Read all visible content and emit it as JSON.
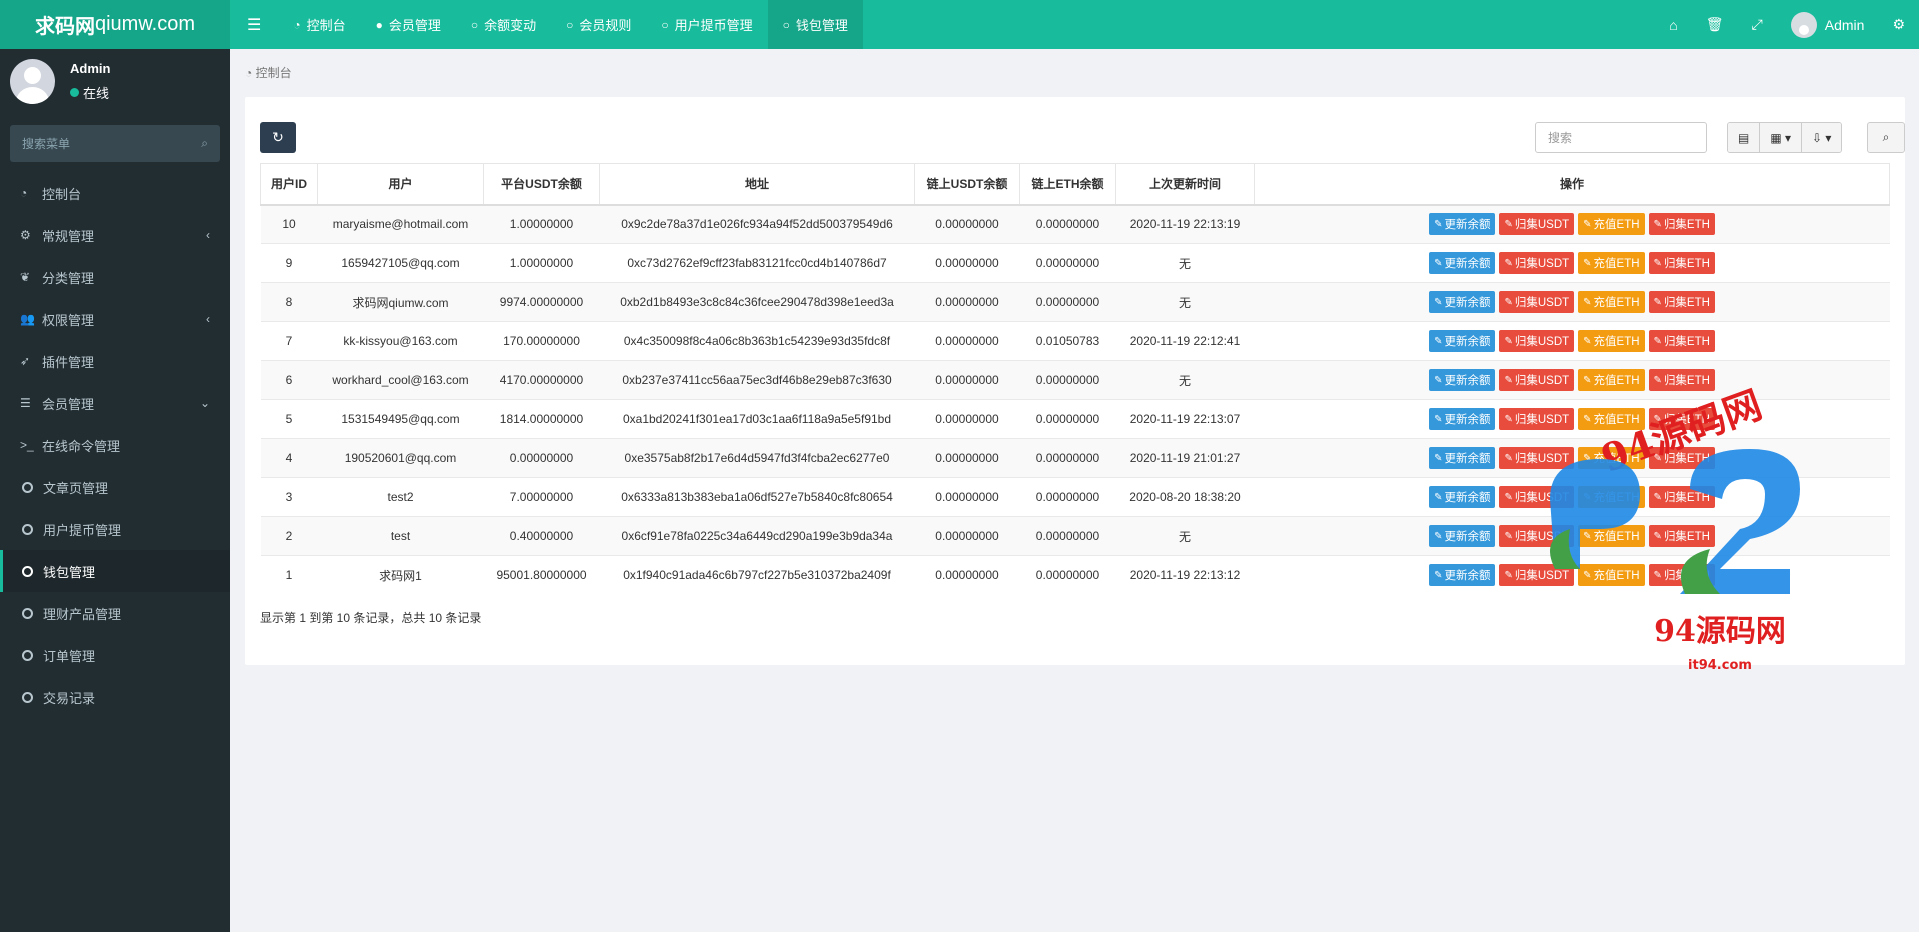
{
  "brand": {
    "title_bold": "求码网",
    "title_rest": "qiumw.com"
  },
  "topnav": {
    "menu_icon": "hamburger-icon",
    "items": [
      {
        "label": "控制台",
        "icon": "dashboard-icon"
      },
      {
        "label": "会员管理",
        "icon": "user-icon"
      },
      {
        "label": "余额变动",
        "icon": "circle-icon"
      },
      {
        "label": "会员规则",
        "icon": "circle-icon"
      },
      {
        "label": "用户提币管理",
        "icon": "circle-icon"
      },
      {
        "label": "钱包管理",
        "icon": "circle-icon",
        "active": true
      }
    ],
    "user_name": "Admin"
  },
  "sidebar": {
    "user_name": "Admin",
    "status": "在线",
    "search_placeholder": "搜索菜单",
    "items": [
      {
        "label": "控制台"
      },
      {
        "label": "常规管理"
      },
      {
        "label": "分类管理"
      },
      {
        "label": "权限管理"
      },
      {
        "label": "插件管理"
      },
      {
        "label": "会员管理"
      },
      {
        "label": "在线命令管理"
      },
      {
        "label": "文章页管理"
      },
      {
        "label": "用户提币管理"
      },
      {
        "label": "钱包管理",
        "active": true
      },
      {
        "label": "理财产品管理"
      },
      {
        "label": "订单管理"
      },
      {
        "label": "交易记录"
      }
    ]
  },
  "breadcrumb": "控制台",
  "toolbar": {
    "search_placeholder": "搜索"
  },
  "table": {
    "headers": [
      "用户ID",
      "用户",
      "平台USDT余额",
      "地址",
      "链上USDT余额",
      "链上ETH余额",
      "上次更新时间",
      "操作"
    ],
    "actions": [
      "更新余额",
      "归集USDT",
      "充值ETH",
      "归集ETH"
    ],
    "rows": [
      [
        "10",
        "maryaisme@hotmail.com",
        "1.00000000",
        "0x9c2de78a37d1e026fc934a94f52dd500379549d6",
        "0.00000000",
        "0.00000000",
        "2020-11-19 22:13:19"
      ],
      [
        "9",
        "1659427105@qq.com",
        "1.00000000",
        "0xc73d2762ef9cff23fab83121fcc0cd4b140786d7",
        "0.00000000",
        "0.00000000",
        "无"
      ],
      [
        "8",
        "求码网qiumw.com",
        "9974.00000000",
        "0xb2d1b8493e3c8c84c36fcee290478d398e1eed3a",
        "0.00000000",
        "0.00000000",
        "无"
      ],
      [
        "7",
        "kk-kissyou@163.com",
        "170.00000000",
        "0x4c350098f8c4a06c8b363b1c54239e93d35fdc8f",
        "0.00000000",
        "0.01050783",
        "2020-11-19 22:12:41"
      ],
      [
        "6",
        "workhard_cool@163.com",
        "4170.00000000",
        "0xb237e37411cc56aa75ec3df46b8e29eb87c3f630",
        "0.00000000",
        "0.00000000",
        "无"
      ],
      [
        "5",
        "1531549495@qq.com",
        "1814.00000000",
        "0xa1bd20241f301ea17d03c1aa6f118a9a5e5f91bd",
        "0.00000000",
        "0.00000000",
        "2020-11-19 22:13:07"
      ],
      [
        "4",
        "190520601@qq.com",
        "0.00000000",
        "0xe3575ab8f2b17e6d4d5947fd3f4fcba2ec6277e0",
        "0.00000000",
        "0.00000000",
        "2020-11-19 21:01:27"
      ],
      [
        "3",
        "test2",
        "7.00000000",
        "0x6333a813b383eba1a06df527e7b5840c8fc80654",
        "0.00000000",
        "0.00000000",
        "2020-08-20 18:38:20"
      ],
      [
        "2",
        "test",
        "0.40000000",
        "0x6cf91e78fa0225c34a6449cd290a199e3b9da34a",
        "0.00000000",
        "0.00000000",
        "无"
      ],
      [
        "1",
        "求码网1",
        "95001.80000000",
        "0x1f940c91ada46c6b797cf227b5e310372ba2409f",
        "0.00000000",
        "0.00000000",
        "2020-11-19 22:13:12"
      ]
    ]
  },
  "pagination_info": "显示第 1 到第 10 条记录，总共 10 条记录",
  "watermark": {
    "text": "94源码网",
    "sub": "it94.com"
  },
  "colors": {
    "accent": "#18bc9c",
    "sidebar": "#222d32",
    "info": "#3498db",
    "danger": "#e74c3c",
    "warning": "#f39c12"
  }
}
